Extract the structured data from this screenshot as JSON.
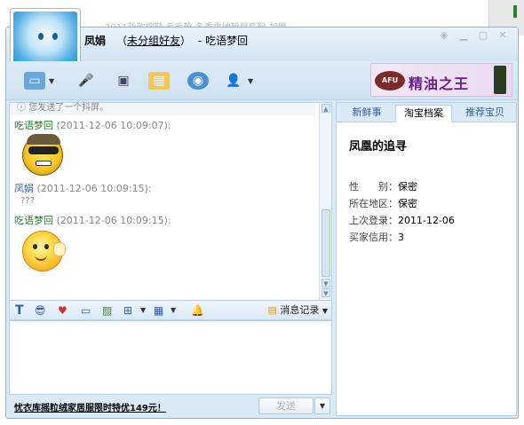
{
  "background": {
    "snippet": "2011新款棉鞋 毛毛靴 冬季雪地靴厚底靴 加厚..."
  },
  "chat_window": {
    "contact_name": "凤娟",
    "contact_group": "未分组好友",
    "separator": " - ",
    "self_name": "吃语梦回",
    "paren_open": "（",
    "paren_close": "）"
  },
  "ad_banner": {
    "logo_text": "AFU",
    "text": "精油之王"
  },
  "chat": {
    "note": "您发送了一个抖屏。",
    "messages": [
      {
        "sender": "吃语梦回",
        "time": "(2011-12-06 10:09:07):",
        "text": ""
      },
      {
        "sender": "凤娟",
        "time": "(2011-12-06 10:09:15):",
        "text": "???"
      },
      {
        "sender": "吃语梦回",
        "time": "(2011-12-06 10:09:15):",
        "text": ""
      }
    ]
  },
  "format_toolbar": {
    "history_label": "消息记录"
  },
  "bottom": {
    "promo_text": "忧衣库摇粒绒家居服限时特优149元！",
    "send_label": "发送"
  },
  "right_panel": {
    "tabs": [
      {
        "label": "新鲜事"
      },
      {
        "label": "淘宝档案"
      },
      {
        "label": "推荐宝贝"
      }
    ],
    "shop_title": "凤凰的追寻",
    "rows": [
      {
        "label": "性　　别：",
        "value": "保密"
      },
      {
        "label": "所在地区：",
        "value": "保密"
      },
      {
        "label": "上次登录：",
        "value": "2011-12-06"
      },
      {
        "label": "买家信用：",
        "value": "3"
      }
    ]
  },
  "colors": {
    "window_border": "#8fb3d3",
    "sender_green": "#2e7d32",
    "sender_blue": "#2b5fa8"
  }
}
